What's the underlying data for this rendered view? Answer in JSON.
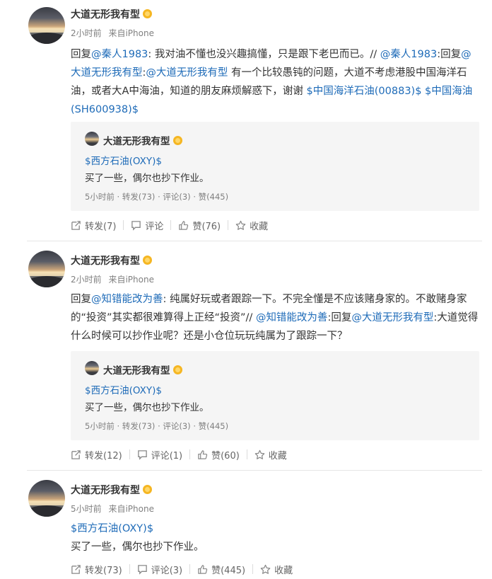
{
  "posts": [
    {
      "username": "大道无形我有型",
      "time": "2小时前",
      "source": "来自iPhone",
      "content_parts": [
        {
          "t": "回复",
          "link": false
        },
        {
          "t": "@秦人1983",
          "link": true
        },
        {
          "t": ": 我对油不懂也没兴趣搞懂，只是跟下老巴而已。// ",
          "link": false
        },
        {
          "t": "@秦人1983",
          "link": true
        },
        {
          "t": ":回复",
          "link": false
        },
        {
          "t": "@大道无形我有型",
          "link": true
        },
        {
          "t": ":",
          "link": false
        },
        {
          "t": "@大道无形我有型",
          "link": true
        },
        {
          "t": " 有一个比较愚钝的问题，大道不考虑港股中国海洋石油，或者大A中海油，知道的朋友麻烦解惑下，谢谢 ",
          "link": false
        },
        {
          "t": "$中国海洋石油(00883)$",
          "link": true
        },
        {
          "t": " ",
          "link": false
        },
        {
          "t": "$中国海油(SH600938)$",
          "link": true
        }
      ],
      "repost": {
        "username": "大道无形我有型",
        "stock_link": "$西方石油(OXY)$",
        "text": "买了一些，偶尔也抄下作业。",
        "time": "5小时前",
        "repost_count": "转发(73)",
        "comment_count": "评论(3)",
        "like_count": "赞(445)"
      },
      "actions": {
        "repost": "转发(7)",
        "comment": "评论",
        "like": "赞(76)",
        "fav": "收藏"
      }
    },
    {
      "username": "大道无形我有型",
      "time": "2小时前",
      "source": "来自iPhone",
      "content_parts": [
        {
          "t": "回复",
          "link": false
        },
        {
          "t": "@知错能改为善",
          "link": true
        },
        {
          "t": ": 纯属好玩或者跟踪一下。不完全懂是不应该赌身家的。不敢赌身家的“投资”其实都很难算得上正经“投资”// ",
          "link": false
        },
        {
          "t": "@知错能改为善",
          "link": true
        },
        {
          "t": ":回复",
          "link": false
        },
        {
          "t": "@大道无形我有型",
          "link": true
        },
        {
          "t": ":大道觉得什么时候可以抄作业呢？还是小仓位玩玩纯属为了跟踪一下？",
          "link": false
        }
      ],
      "repost": {
        "username": "大道无形我有型",
        "stock_link": "$西方石油(OXY)$",
        "text": "买了一些，偶尔也抄下作业。",
        "time": "5小时前",
        "repost_count": "转发(73)",
        "comment_count": "评论(3)",
        "like_count": "赞(445)"
      },
      "actions": {
        "repost": "转发(12)",
        "comment": "评论(1)",
        "like": "赞(60)",
        "fav": "收藏"
      }
    },
    {
      "username": "大道无形我有型",
      "time": "5小时前",
      "source": "来自iPhone",
      "stock_link": "$西方石油(OXY)$",
      "text": "买了一些，偶尔也抄下作业。",
      "actions": {
        "repost": "转发(73)",
        "comment": "评论(3)",
        "like": "赞(445)",
        "fav": "收藏"
      }
    }
  ],
  "colors": {
    "link": "#1e6bb8",
    "badge": "#f5b622",
    "meta": "#808080"
  },
  "icons": [
    "verified-badge-icon",
    "repost-icon",
    "comment-icon",
    "like-icon",
    "favorite-icon"
  ]
}
